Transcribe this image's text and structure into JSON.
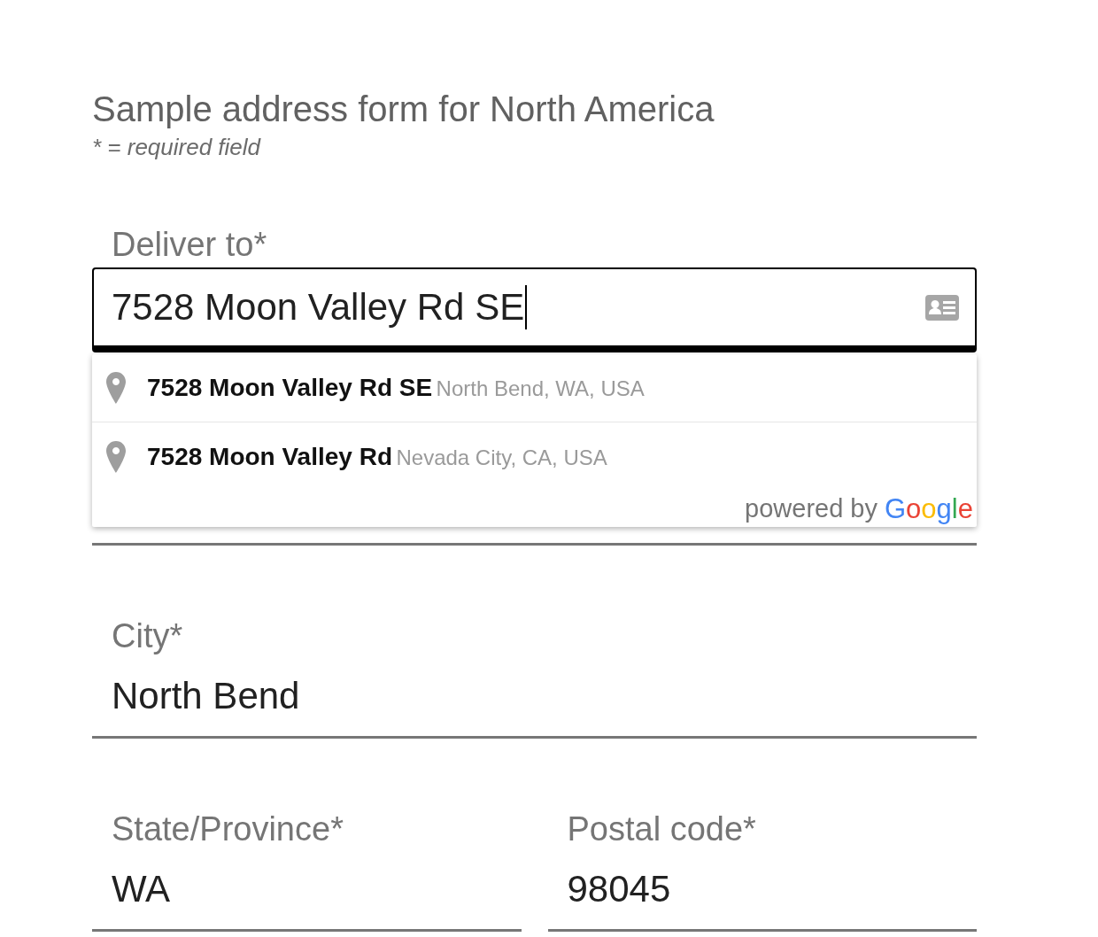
{
  "form": {
    "title": "Sample address form for North America",
    "note": "* = required field"
  },
  "deliver_to": {
    "label": "Deliver to*",
    "value": "7528 Moon Valley Rd SE",
    "focused": true
  },
  "suggestions": [
    {
      "main": "7528 Moon Valley Rd SE",
      "secondary": "North Bend, WA, USA"
    },
    {
      "main": "7528 Moon Valley Rd",
      "secondary": "Nevada City, CA, USA"
    }
  ],
  "attribution": {
    "text": "powered by",
    "logo": "Google"
  },
  "rows": [
    {
      "fields": [
        {
          "label": "City*",
          "value": "North Bend"
        }
      ]
    },
    {
      "fields": [
        {
          "label": "State/Province*",
          "value": "WA"
        },
        {
          "label": "Postal code*",
          "value": "98045"
        }
      ]
    }
  ]
}
